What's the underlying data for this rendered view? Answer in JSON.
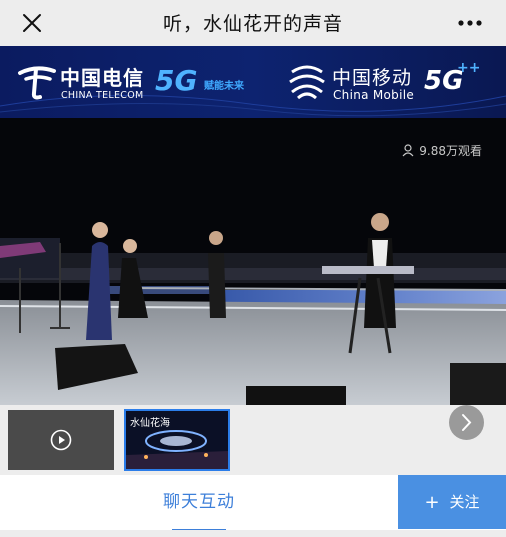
{
  "header": {
    "title": "听，水仙花开的声音",
    "close_icon": "close-icon",
    "more_icon": "more-icon"
  },
  "banner": {
    "telecom_cn": "中国电信",
    "telecom_en": "CHINA TELECOM",
    "telecom_5g": "5G",
    "telecom_slogan": "赋能未来",
    "mobile_cn": "中国移动",
    "mobile_en": "China Mobile",
    "mobile_5g": "5G",
    "mobile_5g_sup": "++",
    "brand_blue": "#0a1a5c"
  },
  "video": {
    "viewers": "9.88万观看"
  },
  "thumbnails": [
    {
      "label": "",
      "type": "play"
    },
    {
      "label": "水仙花海",
      "type": "active"
    }
  ],
  "bottom": {
    "chat_tab": "聊天互动",
    "follow_button": "关注",
    "follow_plus": "+",
    "accent": "#4a90e2"
  }
}
